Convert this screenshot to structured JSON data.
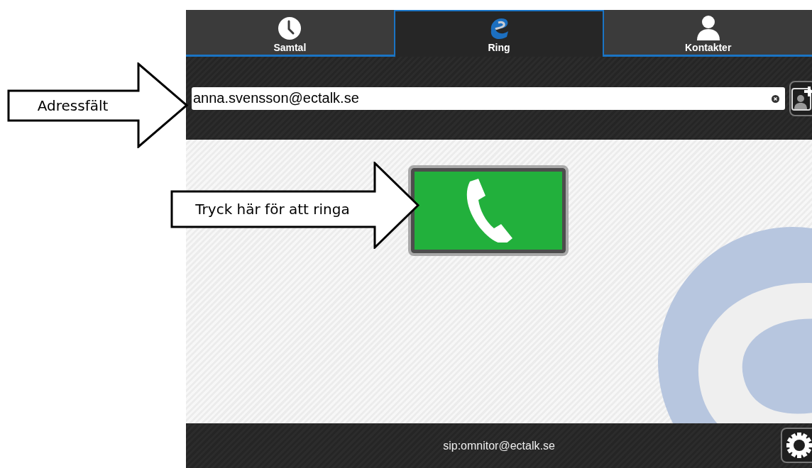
{
  "tabs": [
    {
      "label": "Samtal",
      "kind": "clock",
      "selected": false
    },
    {
      "label": "Ring",
      "kind": "logo",
      "selected": true
    },
    {
      "label": "Kontakter",
      "kind": "person",
      "selected": false
    }
  ],
  "address_field": {
    "value": "anna.svensson@ectalk.se"
  },
  "status_bar": {
    "account": "sip:omnitor@ectalk.se"
  },
  "annotations": [
    {
      "text": "Adressfält"
    },
    {
      "text": "Tryck här för att ringa"
    }
  ]
}
